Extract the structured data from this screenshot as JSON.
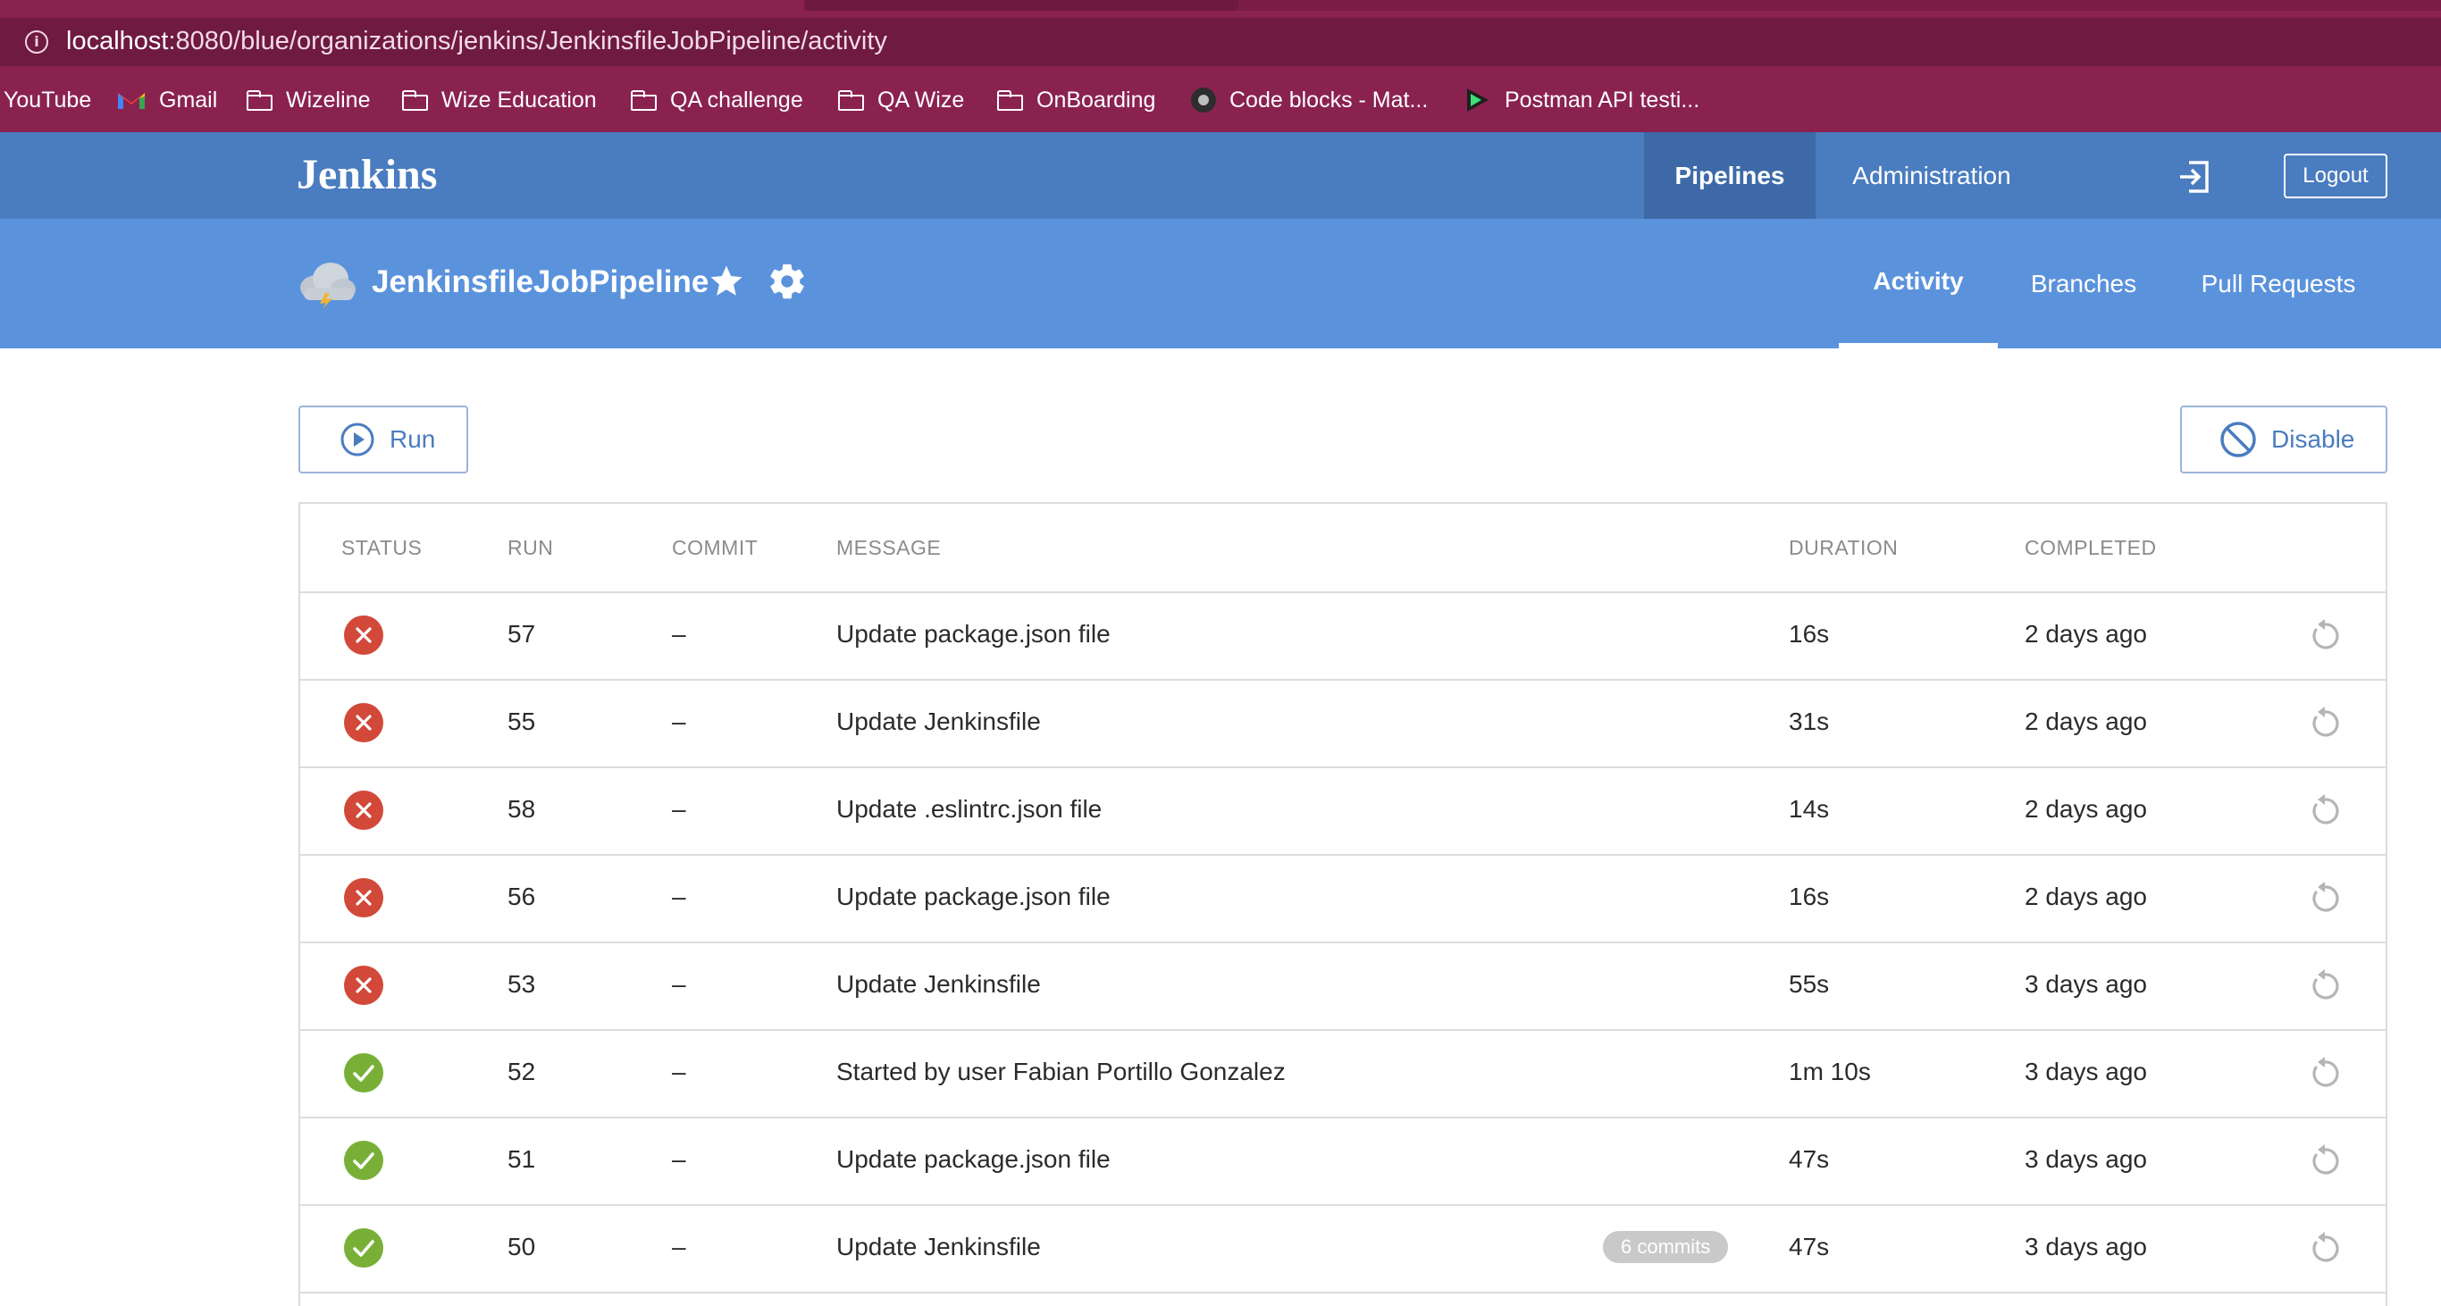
{
  "browser": {
    "url_host": "localhost",
    "url_rest": ":8080/blue/organizations/jenkins/JenkinsfileJobPipeline/activity",
    "bookmarks": [
      {
        "label": "YouTube",
        "icon": "youtube-icon"
      },
      {
        "label": "Gmail",
        "icon": "gmail-icon"
      },
      {
        "label": "Wizeline",
        "icon": "folder-icon"
      },
      {
        "label": "Wize Education",
        "icon": "folder-icon"
      },
      {
        "label": "QA challenge",
        "icon": "folder-icon"
      },
      {
        "label": "QA Wize",
        "icon": "folder-icon"
      },
      {
        "label": "OnBoarding",
        "icon": "folder-icon"
      },
      {
        "label": "Code blocks - Mat...",
        "icon": "code-blocks-icon"
      },
      {
        "label": "Postman API testi...",
        "icon": "postman-icon"
      }
    ]
  },
  "header": {
    "logo": "Jenkins",
    "nav_pipelines": "Pipelines",
    "nav_administration": "Administration",
    "logout": "Logout"
  },
  "pipeline": {
    "name": "JenkinsfileJobPipeline",
    "tabs": [
      "Activity",
      "Branches",
      "Pull Requests"
    ],
    "active_tab": "Activity"
  },
  "actions": {
    "run": "Run",
    "disable": "Disable"
  },
  "table": {
    "columns": [
      "STATUS",
      "RUN",
      "COMMIT",
      "MESSAGE",
      "DURATION",
      "COMPLETED"
    ],
    "rows": [
      {
        "status": "failed",
        "run": "57",
        "commit": "–",
        "message": "Update package.json file",
        "duration": "16s",
        "completed": "2 days ago"
      },
      {
        "status": "failed",
        "run": "55",
        "commit": "–",
        "message": "Update Jenkinsfile",
        "duration": "31s",
        "completed": "2 days ago"
      },
      {
        "status": "failed",
        "run": "58",
        "commit": "–",
        "message": "Update .eslintrc.json file",
        "duration": "14s",
        "completed": "2 days ago"
      },
      {
        "status": "failed",
        "run": "56",
        "commit": "–",
        "message": "Update package.json file",
        "duration": "16s",
        "completed": "2 days ago"
      },
      {
        "status": "failed",
        "run": "53",
        "commit": "–",
        "message": "Update Jenkinsfile",
        "duration": "55s",
        "completed": "3 days ago"
      },
      {
        "status": "success",
        "run": "52",
        "commit": "–",
        "message": "Started by user Fabian Portillo Gonzalez",
        "duration": "1m 10s",
        "completed": "3 days ago"
      },
      {
        "status": "success",
        "run": "51",
        "commit": "–",
        "message": "Update package.json file",
        "duration": "47s",
        "completed": "3 days ago"
      },
      {
        "status": "success",
        "run": "50",
        "commit": "–",
        "message": "Update Jenkinsfile",
        "badge": "6 commits",
        "duration": "47s",
        "completed": "3 days ago"
      }
    ]
  },
  "colors": {
    "failed": "#d24939",
    "success": "#78b037",
    "header": "#4a7cc0",
    "subheader": "#5b92dc",
    "browser": "#8a2250"
  }
}
